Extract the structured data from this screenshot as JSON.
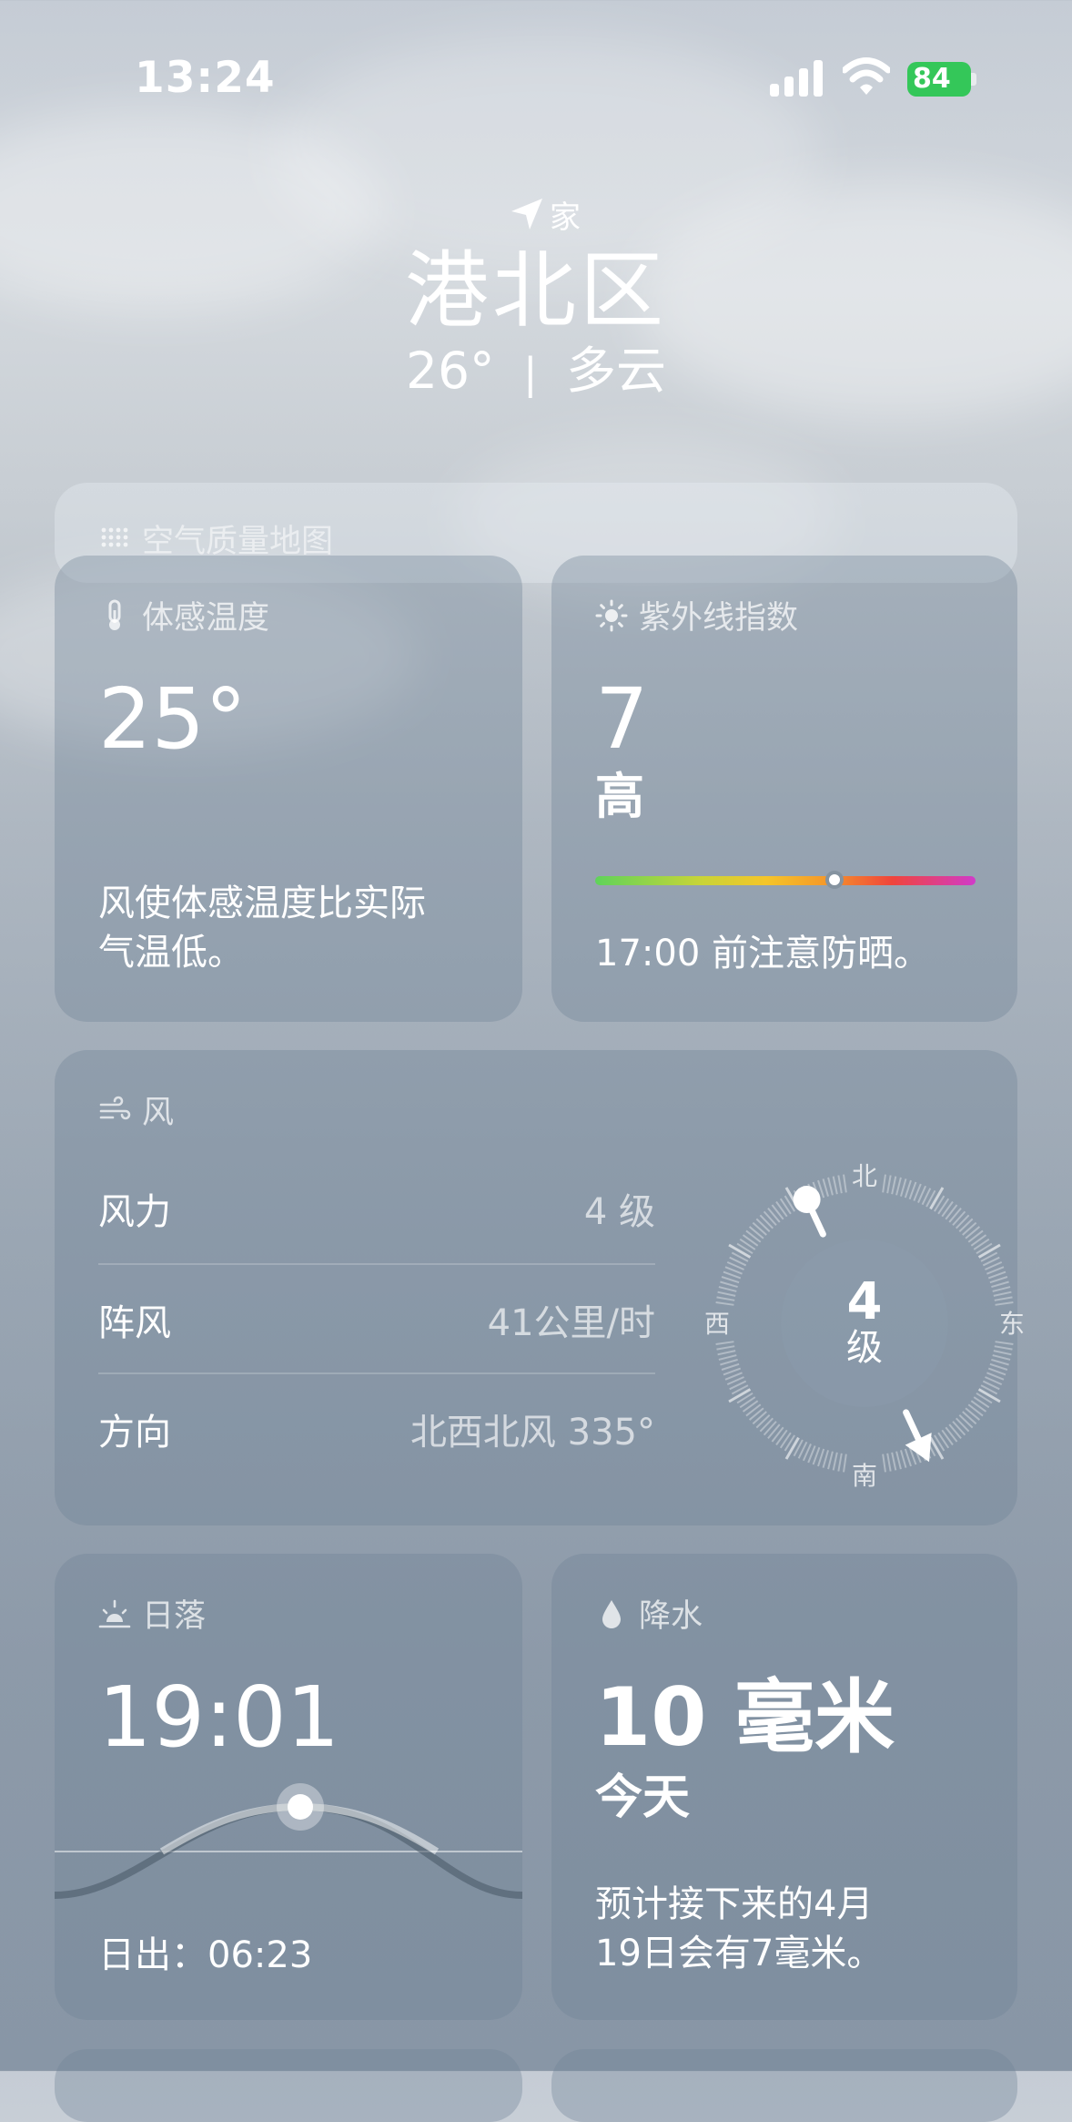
{
  "status": {
    "time": "13:24",
    "battery": "84"
  },
  "header": {
    "location_label": "家",
    "city": "港北区",
    "temp": "26°",
    "separator": "|",
    "condition": "多云"
  },
  "air_quality": {
    "title": "空气质量地图"
  },
  "feels_like": {
    "title": "体感温度",
    "value": "25°",
    "desc_line1": "风使体感温度比实际",
    "desc_line2": "气温低。"
  },
  "uv": {
    "title": "紫外线指数",
    "value": "7",
    "level": "高",
    "level_fraction": 0.63,
    "desc": "17:00 前注意防晒。"
  },
  "wind": {
    "title": "风",
    "rows": [
      {
        "label": "风力",
        "value": "4 级"
      },
      {
        "label": "阵风",
        "value": "41公里/时"
      },
      {
        "label": "方向",
        "value": "北西北风 335°"
      }
    ],
    "compass": {
      "north": "北",
      "south": "南",
      "east": "东",
      "west": "西",
      "speed": "4",
      "unit": "级",
      "direction_deg": 335
    }
  },
  "sunset": {
    "title": "日落",
    "time": "19:01",
    "sunrise": "日出：06:23"
  },
  "precip": {
    "title": "降水",
    "amount": "10 毫米",
    "period": "今天",
    "desc_line1": "预计接下来的4月",
    "desc_line2": "19日会有7毫米。"
  },
  "colors": {
    "battery": "#34c759"
  }
}
